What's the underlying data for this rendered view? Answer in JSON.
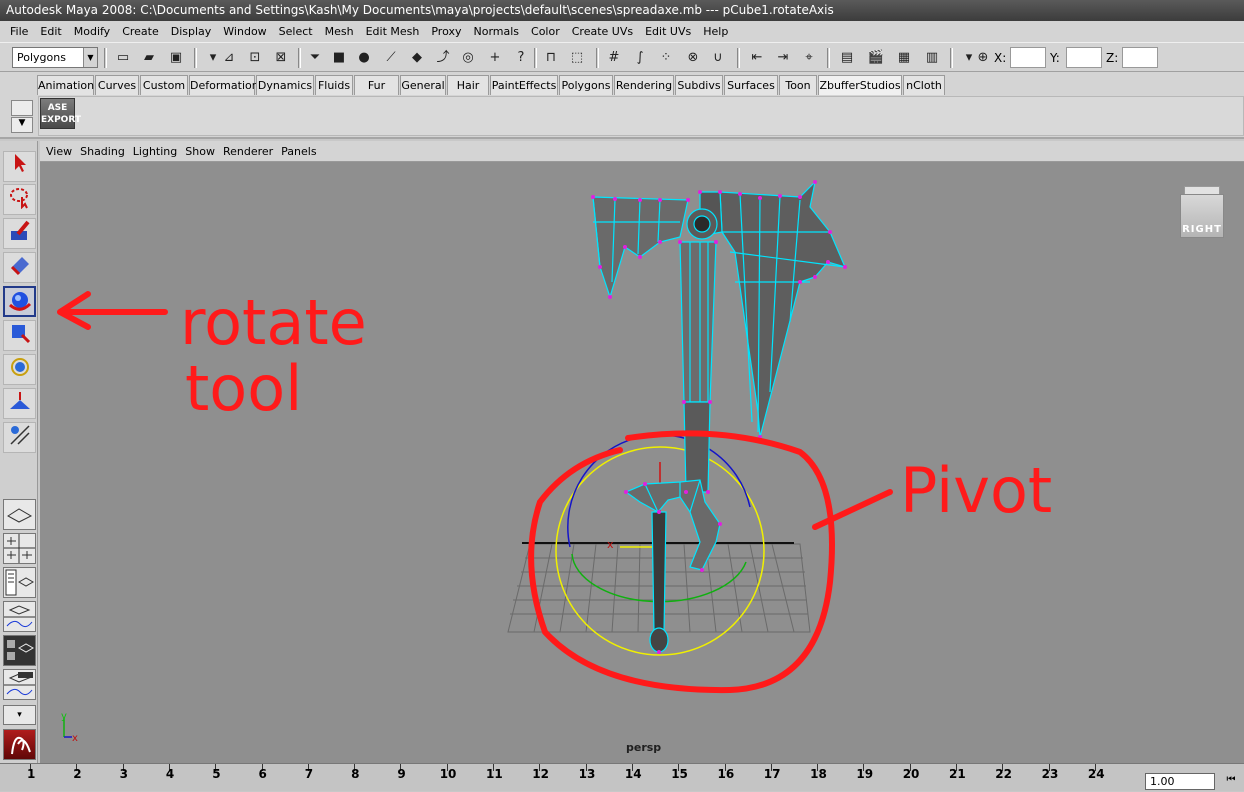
{
  "window": {
    "title": "Autodesk Maya 2008: C:\\Documents and Settings\\Kash\\My Documents\\maya\\projects\\default\\scenes\\spreadaxe.mb    ---    pCube1.rotateAxis"
  },
  "main_menu": [
    "File",
    "Edit",
    "Modify",
    "Create",
    "Display",
    "Window",
    "Select",
    "Mesh",
    "Edit Mesh",
    "Proxy",
    "Normals",
    "Color",
    "Create UVs",
    "Edit UVs",
    "Help"
  ],
  "status_line": {
    "mode": "Polygons",
    "x_label": "X:",
    "y_label": "Y:",
    "z_label": "Z:"
  },
  "shelf_tabs": [
    "Animation",
    "Curves",
    "Custom",
    "Deformation",
    "Dynamics",
    "Fluids",
    "Fur",
    "General",
    "Hair",
    "PaintEffects",
    "Polygons",
    "Rendering",
    "Subdivs",
    "Surfaces",
    "Toon",
    "ZbufferStudios",
    "nCloth"
  ],
  "shelf_active_tab": "ZbufferStudios",
  "shelf_icon_label": "ASE\nEXPORT",
  "panel_menu": [
    "View",
    "Shading",
    "Lighting",
    "Show",
    "Renderer",
    "Panels"
  ],
  "viewport": {
    "camera": "persp",
    "view_cube_label": "RIGHT",
    "axis_x": "x",
    "axis_y": "y"
  },
  "annotations": {
    "rotate_tool_line1": "rotate",
    "rotate_tool_line2": "tool",
    "pivot": "Pivot",
    "color": "#ff1a1a"
  },
  "time_slider": {
    "frames": [
      "1",
      "2",
      "3",
      "4",
      "5",
      "6",
      "7",
      "8",
      "9",
      "10",
      "11",
      "12",
      "13",
      "14",
      "15",
      "16",
      "17",
      "18",
      "19",
      "20",
      "21",
      "22",
      "23",
      "24"
    ],
    "current_frame": "1.00"
  },
  "colors": {
    "mesh_wire": "#00e5ff",
    "vertex": "#e020e0",
    "ring_yellow": "#f0f000",
    "ring_blue": "#1414c8",
    "ring_green": "#10b010",
    "ring_red": "#d01010"
  }
}
